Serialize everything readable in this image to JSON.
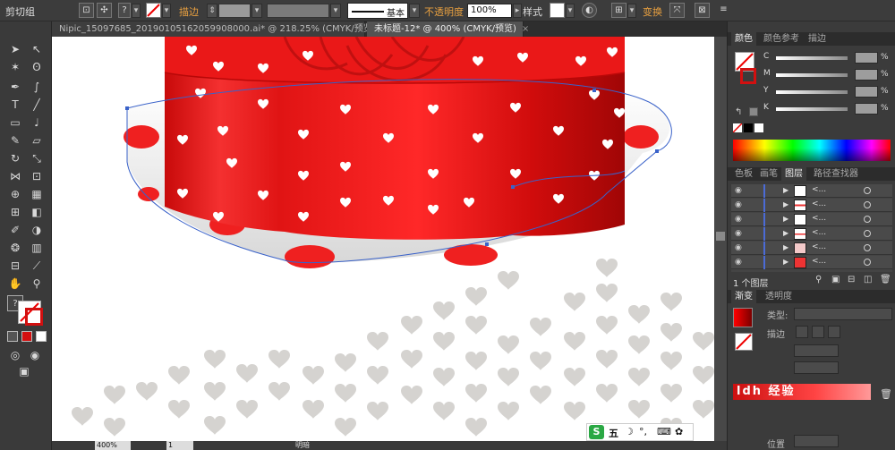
{
  "control_bar": {
    "group_label": "剪切组",
    "stroke_label": "描边",
    "stroke_style": "基本",
    "opacity_label": "不透明度",
    "opacity_value": "100%",
    "style_label": "样式",
    "transform_label": "变换"
  },
  "tabs": [
    {
      "label": "Nipic_15097685_20190105162059908000.ai* @ 218.25% (CMYK/预览)",
      "close": "×"
    },
    {
      "label": "未标题-12* @ 400% (CMYK/预览)",
      "close": "×"
    }
  ],
  "tools": {
    "fill_stroke_hint": "?"
  },
  "color_panel": {
    "tabs": [
      "颜色",
      "颜色参考",
      "描边"
    ],
    "channels": [
      {
        "key": "C",
        "pct": "%"
      },
      {
        "key": "M",
        "pct": "%"
      },
      {
        "key": "Y",
        "pct": "%"
      },
      {
        "key": "K",
        "pct": "%"
      }
    ]
  },
  "layers_panel": {
    "tabs": [
      "色板",
      "画笔",
      "图层",
      "路径查找器"
    ],
    "rows": [
      {
        "name": "<..."
      },
      {
        "name": "<..."
      },
      {
        "name": "<..."
      },
      {
        "name": "<..."
      },
      {
        "name": "<..."
      },
      {
        "name": "<..."
      }
    ],
    "count": "1 个图层"
  },
  "gradient_panel": {
    "tabs": [
      "渐变",
      "透明度"
    ],
    "type_label": "类型:",
    "stroke_label": "描边",
    "position_label": "位置"
  },
  "status_bar": {
    "zoom": "400%",
    "page": "1",
    "mode": "明暗"
  },
  "ime": {
    "logo": "S",
    "mode": "五"
  },
  "banner": {
    "text": "ldh 经验"
  },
  "colors": {
    "cake_red": "#e21a1a",
    "accent": "#e8a040",
    "path_blue": "#3a62c9"
  }
}
